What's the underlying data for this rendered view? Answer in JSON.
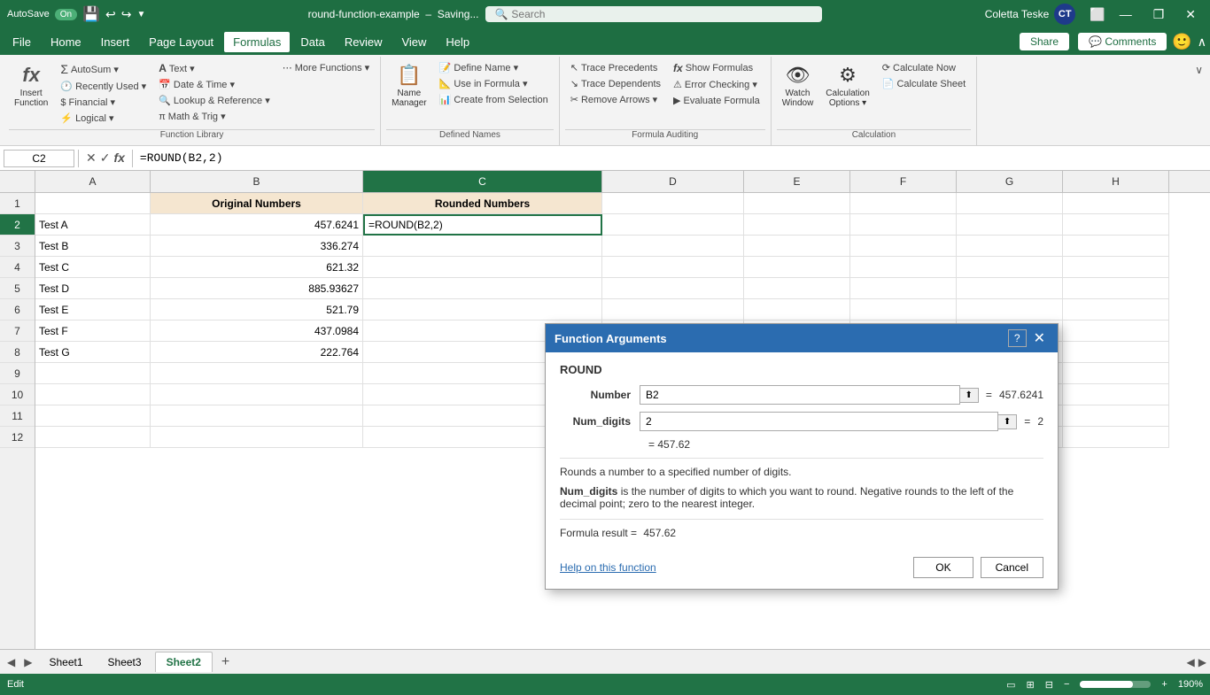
{
  "titleBar": {
    "autosave": "AutoSave",
    "autosaveState": "On",
    "filename": "round-function-example",
    "savingLabel": "Saving...",
    "searchPlaceholder": "Search",
    "userName": "Coletta Teske",
    "userInitials": "CT",
    "windowControls": {
      "minimize": "—",
      "maximize": "❐",
      "close": "✕"
    }
  },
  "menuBar": {
    "items": [
      "File",
      "Home",
      "Insert",
      "Page Layout",
      "Formulas",
      "Data",
      "Review",
      "View",
      "Help"
    ],
    "activeItem": "Formulas",
    "shareLabel": "Share",
    "commentsLabel": "Comments"
  },
  "ribbon": {
    "groups": [
      {
        "label": "Function Library",
        "buttons": [
          {
            "id": "insert-function",
            "label": "Insert\nFunction",
            "icon": "fx"
          },
          {
            "id": "autosum",
            "label": "AutoSum",
            "icon": "Σ",
            "hasDropdown": true
          },
          {
            "id": "recently-used",
            "label": "Recently\nUsed",
            "icon": "🕐",
            "hasDropdown": true
          },
          {
            "id": "financial",
            "label": "Financial",
            "icon": "💰",
            "hasDropdown": true
          },
          {
            "id": "logical",
            "label": "Logical",
            "icon": "⚡",
            "hasDropdown": true
          },
          {
            "id": "text",
            "label": "Text",
            "icon": "A",
            "hasDropdown": true
          },
          {
            "id": "date-time",
            "label": "Date &\nTime",
            "icon": "📅",
            "hasDropdown": true
          },
          {
            "id": "lookup-reference",
            "label": "Lookup &\nReference",
            "icon": "🔍",
            "hasDropdown": true
          },
          {
            "id": "math-trig",
            "label": "Math &\nTrig",
            "icon": "π",
            "hasDropdown": true
          },
          {
            "id": "more-functions",
            "label": "More\nFunctions",
            "icon": "⋯",
            "hasDropdown": true
          }
        ]
      },
      {
        "label": "Defined Names",
        "buttons": [
          {
            "id": "name-manager",
            "label": "Name\nManager",
            "icon": "📋"
          },
          {
            "id": "define-name",
            "label": "Define Name",
            "icon": "📝",
            "hasDropdown": true
          },
          {
            "id": "use-in-formula",
            "label": "Use in Formula",
            "icon": "📐",
            "hasDropdown": true
          },
          {
            "id": "create-from-selection",
            "label": "Create from Selection",
            "icon": "📊"
          }
        ]
      },
      {
        "label": "Formula Auditing",
        "buttons": [
          {
            "id": "trace-precedents",
            "label": "Trace Precedents",
            "icon": "↖"
          },
          {
            "id": "trace-dependents",
            "label": "Trace Dependents",
            "icon": "↘"
          },
          {
            "id": "remove-arrows",
            "label": "Remove Arrows",
            "icon": "✂",
            "hasDropdown": true
          },
          {
            "id": "show-formulas",
            "label": "Show Formulas",
            "icon": "fx"
          },
          {
            "id": "error-checking",
            "label": "Error Checking",
            "icon": "⚠",
            "hasDropdown": true
          },
          {
            "id": "evaluate-formula",
            "label": "Evaluate Formula",
            "icon": "▶"
          }
        ]
      },
      {
        "label": "Calculation",
        "buttons": [
          {
            "id": "watch-window",
            "label": "Watch\nWindow",
            "icon": "👁"
          },
          {
            "id": "calculation-options",
            "label": "Calculation\nOptions",
            "icon": "⚙",
            "hasDropdown": true
          },
          {
            "id": "calculate-now",
            "label": "Calculate Now",
            "icon": "⟳"
          },
          {
            "id": "calculate-sheet",
            "label": "Calculate Sheet",
            "icon": "📄"
          }
        ]
      }
    ]
  },
  "formulaBar": {
    "cellRef": "C2",
    "formula": "=ROUND(B2,2)"
  },
  "spreadsheet": {
    "columns": [
      "A",
      "B",
      "C",
      "D",
      "E",
      "F",
      "G",
      "H"
    ],
    "selectedCol": "C",
    "selectedRow": 2,
    "headers": {
      "B": "Original Numbers",
      "C": "Rounded Numbers"
    },
    "rows": [
      {
        "num": 1,
        "A": "",
        "B": "Original Numbers",
        "C": "Rounded Numbers",
        "D": "",
        "E": "",
        "F": "",
        "G": "",
        "H": ""
      },
      {
        "num": 2,
        "A": "Test A",
        "B": "457.6241",
        "C": "=ROUND(B2,2)",
        "D": "",
        "E": "",
        "F": "",
        "G": "",
        "H": ""
      },
      {
        "num": 3,
        "A": "Test B",
        "B": "336.274",
        "C": "",
        "D": "",
        "E": "",
        "F": "",
        "G": "",
        "H": ""
      },
      {
        "num": 4,
        "A": "Test C",
        "B": "621.32",
        "C": "",
        "D": "",
        "E": "",
        "F": "",
        "G": "",
        "H": ""
      },
      {
        "num": 5,
        "A": "Test D",
        "B": "885.93627",
        "C": "",
        "D": "",
        "E": "",
        "F": "",
        "G": "",
        "H": ""
      },
      {
        "num": 6,
        "A": "Test E",
        "B": "521.79",
        "C": "",
        "D": "",
        "E": "",
        "F": "",
        "G": "",
        "H": ""
      },
      {
        "num": 7,
        "A": "Test F",
        "B": "437.0984",
        "C": "",
        "D": "",
        "E": "",
        "F": "",
        "G": "",
        "H": ""
      },
      {
        "num": 8,
        "A": "Test G",
        "B": "222.764",
        "C": "",
        "D": "",
        "E": "",
        "F": "",
        "G": "",
        "H": ""
      },
      {
        "num": 9,
        "A": "",
        "B": "",
        "C": "",
        "D": "",
        "E": "",
        "F": "",
        "G": "",
        "H": ""
      },
      {
        "num": 10,
        "A": "",
        "B": "",
        "C": "",
        "D": "",
        "E": "",
        "F": "",
        "G": "",
        "H": ""
      },
      {
        "num": 11,
        "A": "",
        "B": "",
        "C": "",
        "D": "",
        "E": "",
        "F": "",
        "G": "",
        "H": ""
      },
      {
        "num": 12,
        "A": "",
        "B": "",
        "C": "",
        "D": "",
        "E": "",
        "F": "",
        "G": "",
        "H": ""
      }
    ]
  },
  "dialog": {
    "title": "Function Arguments",
    "funcName": "ROUND",
    "numberLabel": "Number",
    "numberValue": "B2",
    "numberResult": "457.6241",
    "numDigitsLabel": "Num_digits",
    "numDigitsValue": "2",
    "numDigitsResult": "2",
    "formulaResult": "= 457.62",
    "description": "Rounds a number to a specified number of digits.",
    "paramLabel": "Num_digits",
    "paramDesc": "is the number of digits to which you want to round. Negative rounds to the left of the decimal point; zero to the nearest integer.",
    "formulaResultLabel": "Formula result =",
    "formulaResultValue": "457.62",
    "helpLink": "Help on this function",
    "okLabel": "OK",
    "cancelLabel": "Cancel"
  },
  "sheetTabs": {
    "tabs": [
      "Sheet1",
      "Sheet3",
      "Sheet2"
    ],
    "activeTab": "Sheet2"
  },
  "statusBar": {
    "mode": "Edit",
    "zoom": "190%"
  }
}
